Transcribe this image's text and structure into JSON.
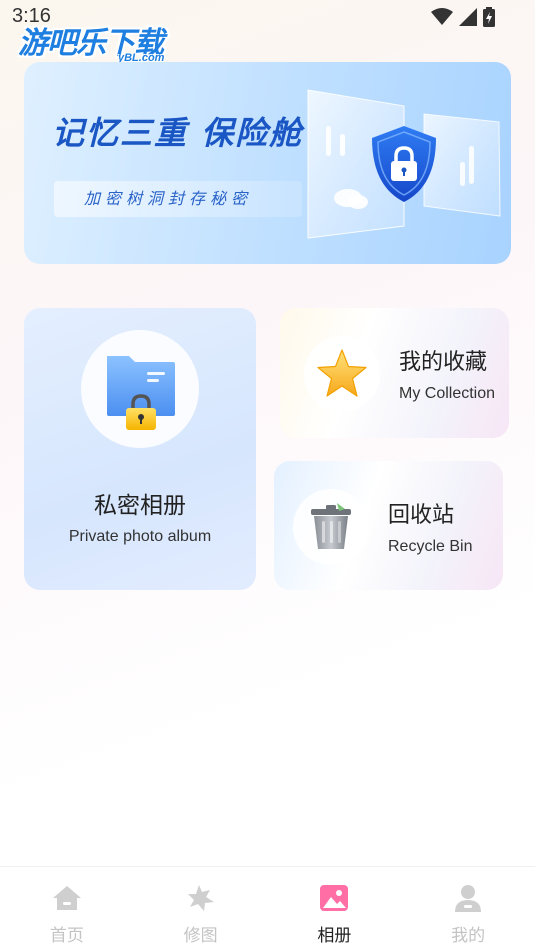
{
  "status_bar": {
    "time": "3:16",
    "icons": [
      "wifi-icon",
      "signal-icon",
      "battery-icon"
    ]
  },
  "watermark": {
    "main": "游吧乐下载",
    "sub": "yBL.com"
  },
  "banner": {
    "title": "记忆三重 保险舱",
    "subtitle": "加密树洞封存秘密",
    "icon": "shield-lock-icon"
  },
  "cards": {
    "private_album": {
      "label": "私密相册",
      "sublabel": "Private photo album",
      "icon": "folder-lock-icon"
    },
    "collection": {
      "label": "我的收藏",
      "sublabel": "My Collection",
      "icon": "star-icon"
    },
    "recycle_bin": {
      "label": "回收站",
      "sublabel": "Recycle Bin",
      "icon": "trash-icon"
    }
  },
  "bottom_nav": {
    "items": [
      {
        "label": "首页",
        "icon": "home-icon",
        "active": false
      },
      {
        "label": "修图",
        "icon": "edit-photo-icon",
        "active": false
      },
      {
        "label": "相册",
        "icon": "album-icon",
        "active": true
      },
      {
        "label": "我的",
        "icon": "profile-icon",
        "active": false
      }
    ]
  },
  "colors": {
    "accent": "#1a56c4",
    "nav_active": "#ff6fa5",
    "nav_inactive": "#cfcfcf"
  }
}
